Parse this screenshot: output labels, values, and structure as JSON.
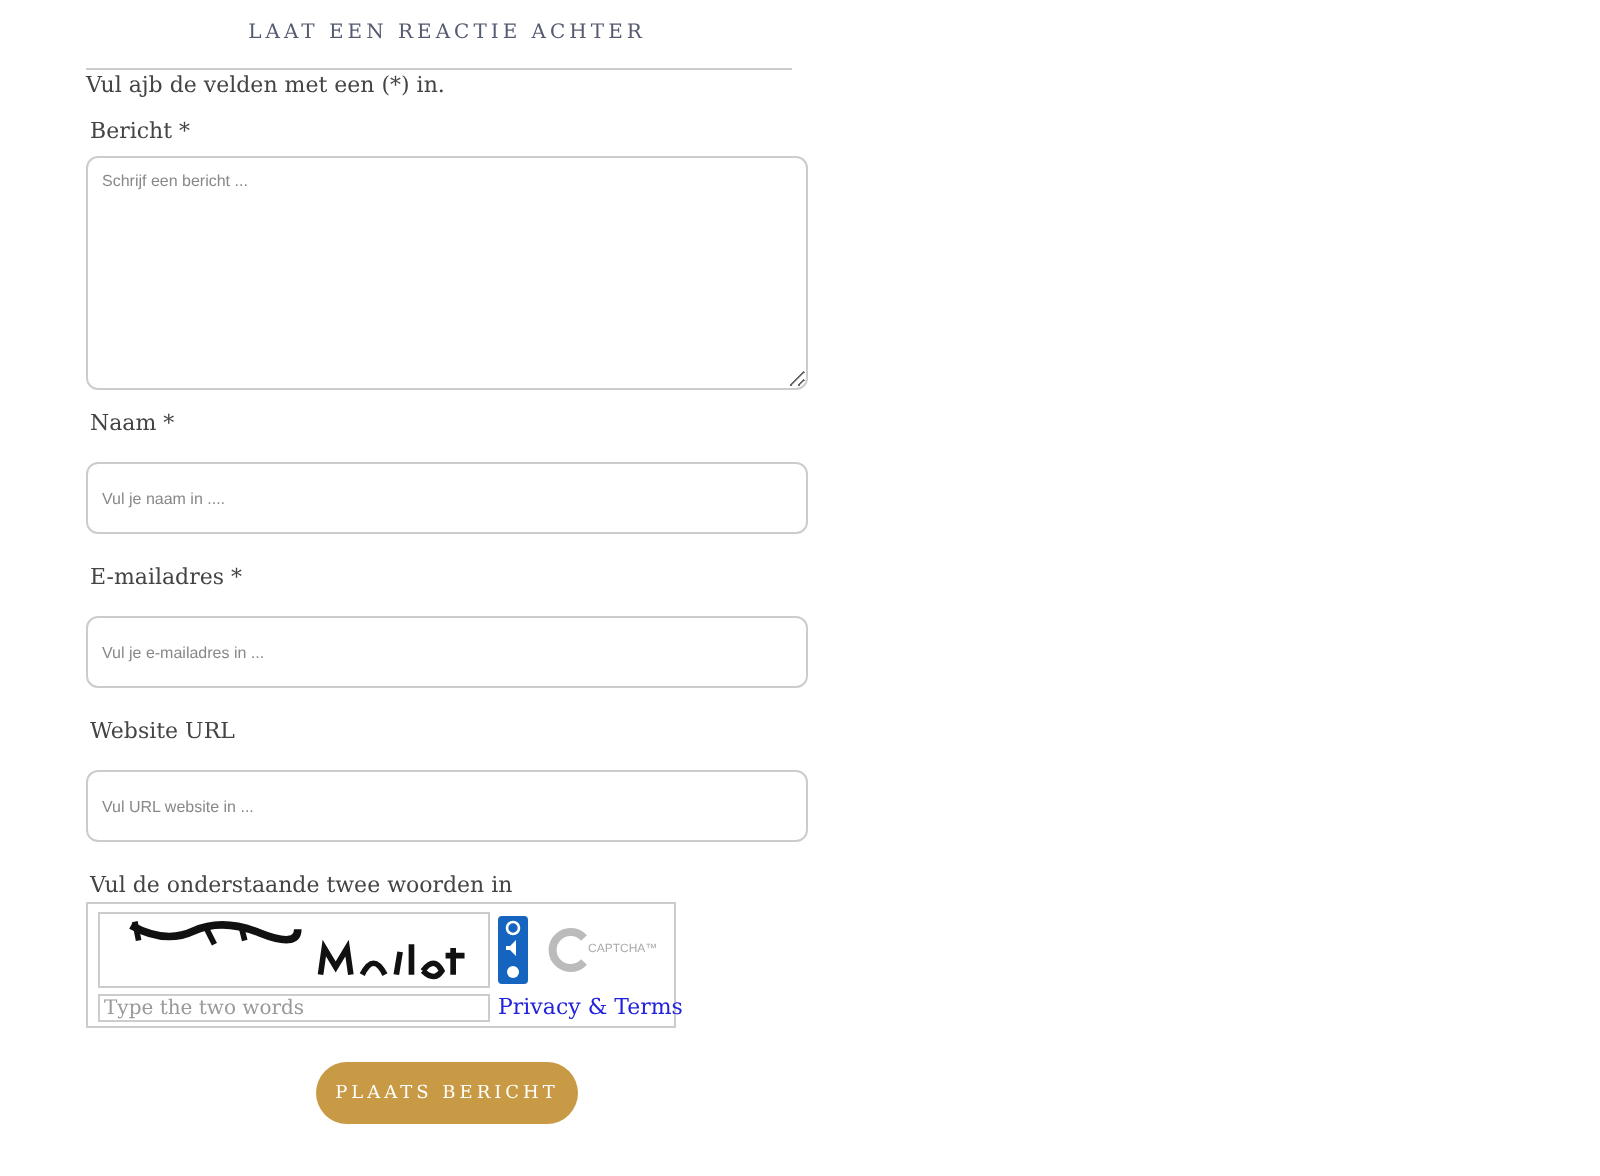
{
  "heading": "LAAT EEN REACTIE ACHTER",
  "note": "Vul ajb de velden met een (*) in.",
  "fields": [
    {
      "label": "Bericht *",
      "placeholder": "Schrijf een bericht ...",
      "kind": "textarea"
    },
    {
      "label": "Naam *",
      "placeholder": "Vul je naam in ....",
      "kind": "input"
    },
    {
      "label": "E-mailadres *",
      "placeholder": "Vul je e-mailadres in ...",
      "kind": "input"
    },
    {
      "label": "Website URL",
      "placeholder": "Vul URL website in ...",
      "kind": "input"
    }
  ],
  "captcha": {
    "label": "Vul de onderstaande twee woorden in",
    "placeholder": "Type the two words",
    "link": "Privacy & Terms",
    "logo": "CAPTCHA™"
  },
  "submit": "PLAATS BERICHT"
}
